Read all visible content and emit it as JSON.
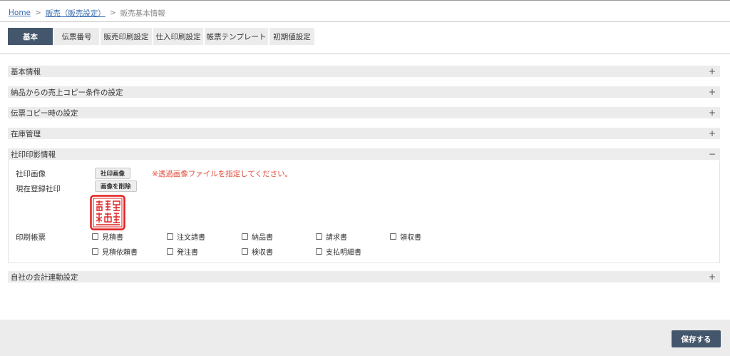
{
  "breadcrumb": {
    "home": "Home",
    "sales": "販売（販売設定）",
    "current": "販売基本情報",
    "separator": ">"
  },
  "tabs": [
    {
      "label": "基本",
      "active": true
    },
    {
      "label": "伝票番号",
      "active": false
    },
    {
      "label": "販売印刷設定",
      "active": false
    },
    {
      "label": "仕入印刷設定",
      "active": false
    },
    {
      "label": "帳票テンプレート",
      "active": false
    },
    {
      "label": "初期値設定",
      "active": false
    }
  ],
  "sections": [
    {
      "title": "基本情報",
      "toggle": "+"
    },
    {
      "title": "納品からの売上コピー条件の設定",
      "toggle": "+"
    },
    {
      "title": "伝票コピー時の設定",
      "toggle": "+"
    },
    {
      "title": "在庫管理",
      "toggle": "+"
    },
    {
      "title": "社印印影情報",
      "toggle": "−"
    },
    {
      "title": "自社の会計連動設定",
      "toggle": "+"
    }
  ],
  "seal_panel": {
    "seal_image_label": "社印画像",
    "seal_image_button": "社印画像",
    "warning": "※透過画像ファイルを指定してください。",
    "current_seal_label": "現在登録社印",
    "delete_button": "画像を削除",
    "print_forms_label": "印刷帳票",
    "forms_row1": [
      "見積書",
      "注文請書",
      "納品書",
      "請求書",
      "領収書"
    ],
    "forms_row2": [
      "見積依頼書",
      "発注書",
      "検収書",
      "支払明細書"
    ]
  },
  "footer": {
    "save_label": "保存する"
  },
  "colors": {
    "primary": "#44566c",
    "section_bg": "#ececec",
    "link": "#3b6fb0",
    "warning": "#e04b3a",
    "seal_red": "#e02020"
  }
}
